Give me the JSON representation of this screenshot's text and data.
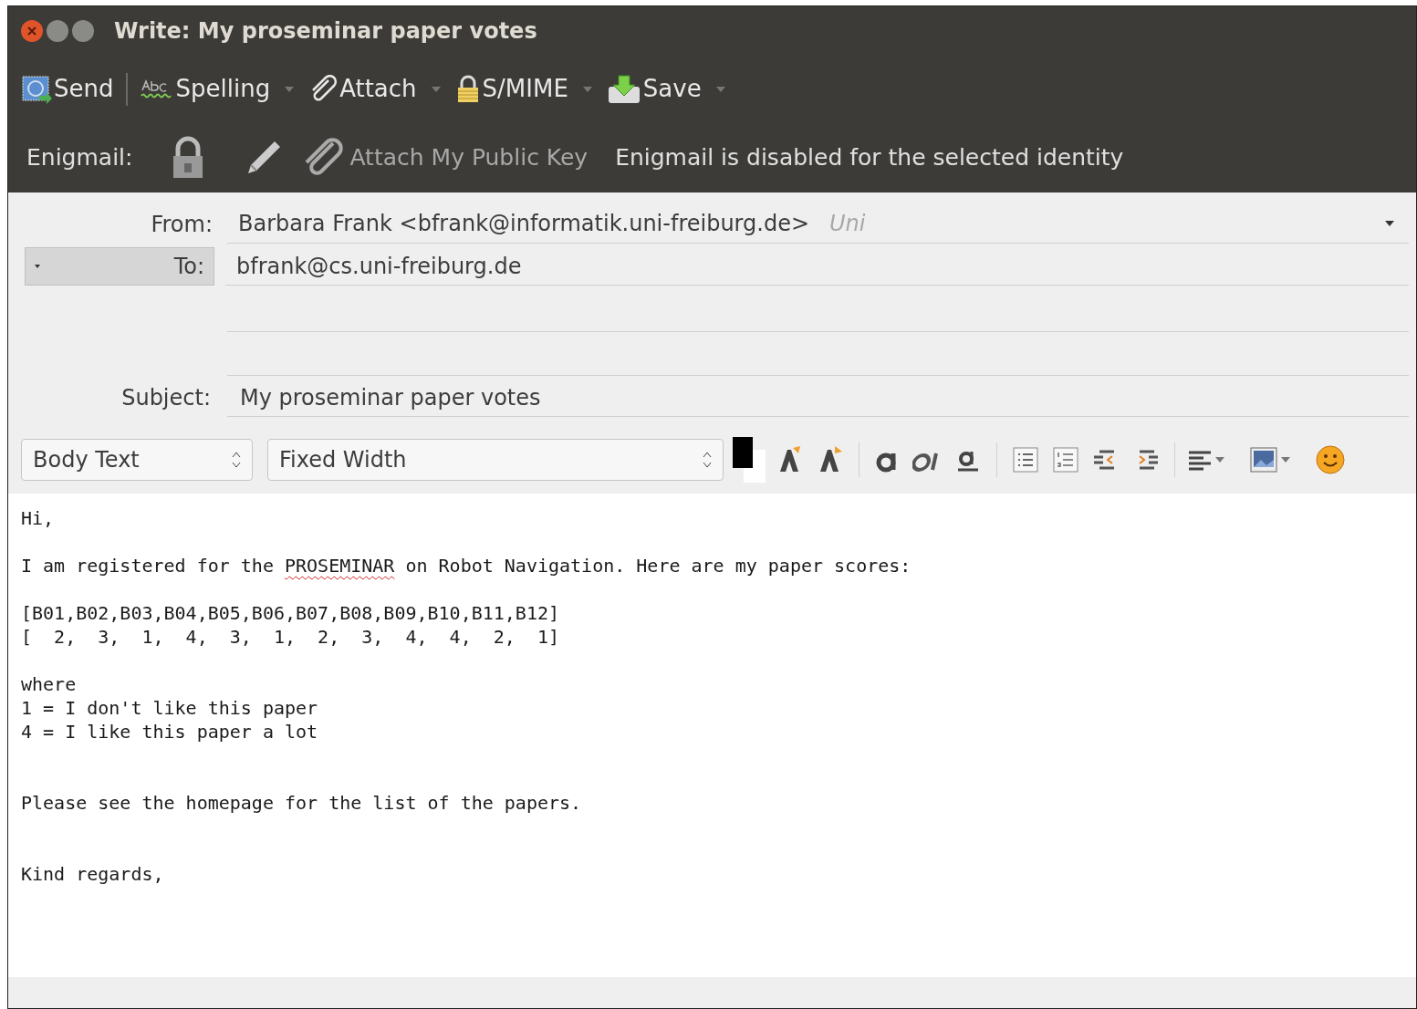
{
  "window": {
    "title": "Write: My proseminar paper votes"
  },
  "toolbar": [
    {
      "kind": "send",
      "label": "Send",
      "dropdown": false
    },
    {
      "kind": "spelling",
      "label": "Spelling",
      "dropdown": true
    },
    {
      "kind": "attach",
      "label": "Attach",
      "dropdown": true
    },
    {
      "kind": "smime",
      "label": "S/MIME",
      "dropdown": true
    },
    {
      "kind": "save",
      "label": "Save",
      "dropdown": true
    }
  ],
  "enigmail": {
    "label": "Enigmail:",
    "attach_key": "Attach My Public Key",
    "status": "Enigmail is disabled for the selected identity"
  },
  "headers": {
    "from_label": "From:",
    "from_value": "Barbara Frank <bfrank@informatik.uni-freiburg.de>",
    "from_identity": "Uni",
    "to_label": "To:",
    "to_value": "bfrank@cs.uni-freiburg.de",
    "subject_label": "Subject:",
    "subject_value": "My proseminar paper votes"
  },
  "format": {
    "paragraph_style": "Body Text",
    "font": "Fixed Width"
  },
  "body": [
    {
      "kind": "text",
      "segments": [
        {
          "text": "Hi,",
          "misspelled": false
        }
      ]
    },
    {
      "kind": "blank"
    },
    {
      "kind": "text",
      "segments": [
        {
          "text": "I am registered for the ",
          "misspelled": false
        },
        {
          "text": "PROSEMINAR",
          "misspelled": true
        },
        {
          "text": " on Robot Navigation. Here are my paper scores:",
          "misspelled": false
        }
      ]
    },
    {
      "kind": "blank"
    },
    {
      "kind": "text",
      "segments": [
        {
          "text": "[B01,B02,B03,B04,B05,B06,B07,B08,B09,B10,B11,B12]",
          "misspelled": false
        }
      ]
    },
    {
      "kind": "text",
      "segments": [
        {
          "text": "[  2,  3,  1,  4,  3,  1,  2,  3,  4,  4,  2,  1]",
          "misspelled": false
        }
      ]
    },
    {
      "kind": "blank"
    },
    {
      "kind": "text",
      "segments": [
        {
          "text": "where",
          "misspelled": false
        }
      ]
    },
    {
      "kind": "text",
      "segments": [
        {
          "text": "1 = I don't like this paper",
          "misspelled": false
        }
      ]
    },
    {
      "kind": "text",
      "segments": [
        {
          "text": "4 = I like this paper a lot",
          "misspelled": false
        }
      ]
    },
    {
      "kind": "blank"
    },
    {
      "kind": "blank"
    },
    {
      "kind": "text",
      "segments": [
        {
          "text": "Please see the homepage for the list of the papers.",
          "misspelled": false
        }
      ]
    },
    {
      "kind": "blank"
    },
    {
      "kind": "blank"
    },
    {
      "kind": "text",
      "segments": [
        {
          "text": "Kind regards,",
          "misspelled": false
        }
      ]
    }
  ]
}
